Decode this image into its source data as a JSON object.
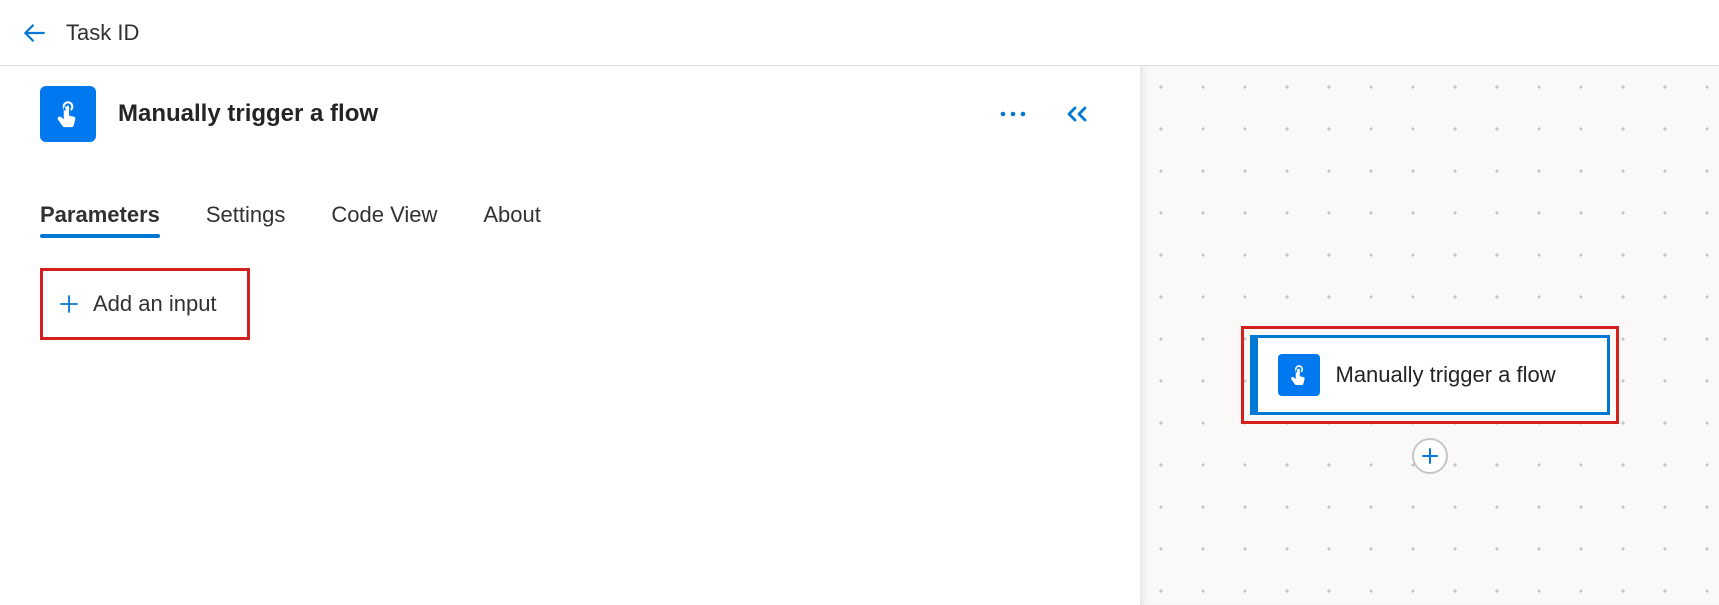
{
  "header": {
    "title": "Task ID"
  },
  "step": {
    "title": "Manually trigger a flow"
  },
  "tabs": [
    {
      "label": "Parameters",
      "active": true
    },
    {
      "label": "Settings",
      "active": false
    },
    {
      "label": "Code View",
      "active": false
    },
    {
      "label": "About",
      "active": false
    }
  ],
  "parameters": {
    "add_input_label": "Add an input"
  },
  "canvas": {
    "card_title": "Manually trigger a flow"
  }
}
